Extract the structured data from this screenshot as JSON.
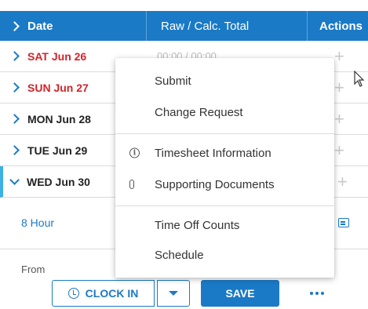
{
  "header": {
    "date_label": "Date",
    "total_label": "Raw / Calc. Total",
    "actions_label": "Actions"
  },
  "rows": [
    {
      "label": "SAT Jun 26",
      "total": "00:00 / 00:00",
      "weekend": true
    },
    {
      "label": "SUN Jun 27",
      "total": "",
      "weekend": true
    },
    {
      "label": "MON Jun 28",
      "total": "",
      "weekend": false
    },
    {
      "label": "TUE Jun 29",
      "total": "",
      "weekend": false
    },
    {
      "label": "WED Jun 30",
      "total": "",
      "weekend": false,
      "expanded": true
    }
  ],
  "expanded": {
    "hour_label": "8 Hour",
    "from_label": "From"
  },
  "menu": {
    "submit": "Submit",
    "change_request": "Change Request",
    "timesheet_info": "Timesheet Information",
    "supporting_docs": "Supporting Documents",
    "time_off_counts": "Time Off Counts",
    "schedule": "Schedule"
  },
  "toolbar": {
    "clock_in_label": "CLOCK IN",
    "save_label": "SAVE"
  },
  "icons": {
    "chevron": "chevron-right-icon",
    "expand": "chevron-down-icon",
    "info": "info-icon",
    "attachment": "paperclip-icon",
    "more": "ellipsis-icon",
    "comment": "comment-icon",
    "clock": "clock-in-icon"
  },
  "colors": {
    "primary": "#1a7ac6",
    "weekend": "#d4232a",
    "selected_bar": "#3db0e6"
  }
}
